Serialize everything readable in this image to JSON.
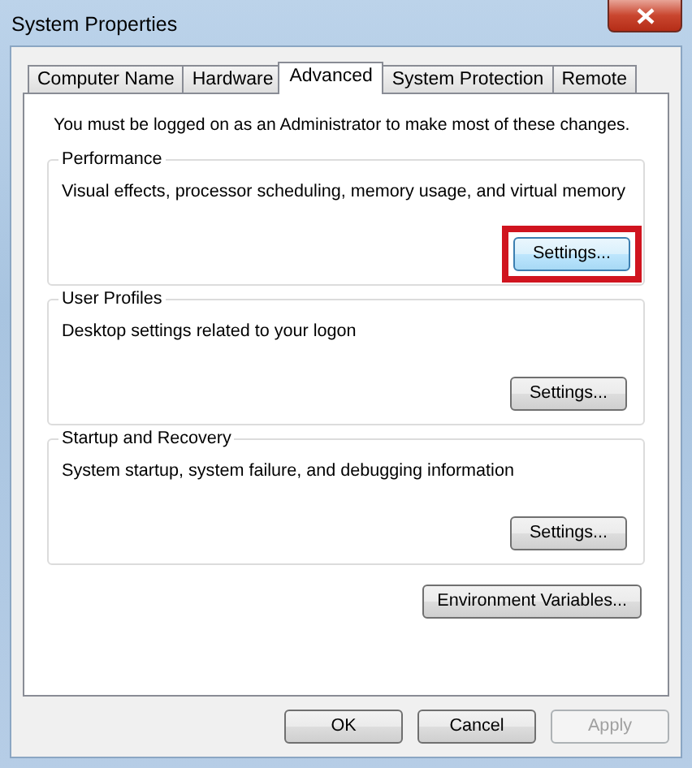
{
  "window": {
    "title": "System Properties"
  },
  "tabs": [
    {
      "label": "Computer Name",
      "selected": false
    },
    {
      "label": "Hardware",
      "selected": false
    },
    {
      "label": "Advanced",
      "selected": true
    },
    {
      "label": "System Protection",
      "selected": false
    },
    {
      "label": "Remote",
      "selected": false
    }
  ],
  "notice": "You must be logged on as an Administrator to make most of these changes.",
  "groups": [
    {
      "title": "Performance",
      "description": "Visual effects, processor scheduling, memory usage, and virtual memory",
      "button": {
        "label": "Settings...",
        "focused": true,
        "highlighted": true
      }
    },
    {
      "title": "User Profiles",
      "description": "Desktop settings related to your logon",
      "button": {
        "label": "Settings...",
        "focused": false,
        "highlighted": false
      }
    },
    {
      "title": "Startup and Recovery",
      "description": "System startup, system failure, and debugging information",
      "button": {
        "label": "Settings...",
        "focused": false,
        "highlighted": false
      }
    }
  ],
  "environment_button": {
    "label": "Environment Variables..."
  },
  "footer_buttons": [
    {
      "label": "OK",
      "disabled": false
    },
    {
      "label": "Cancel",
      "disabled": false
    },
    {
      "label": "Apply",
      "disabled": true
    }
  ]
}
